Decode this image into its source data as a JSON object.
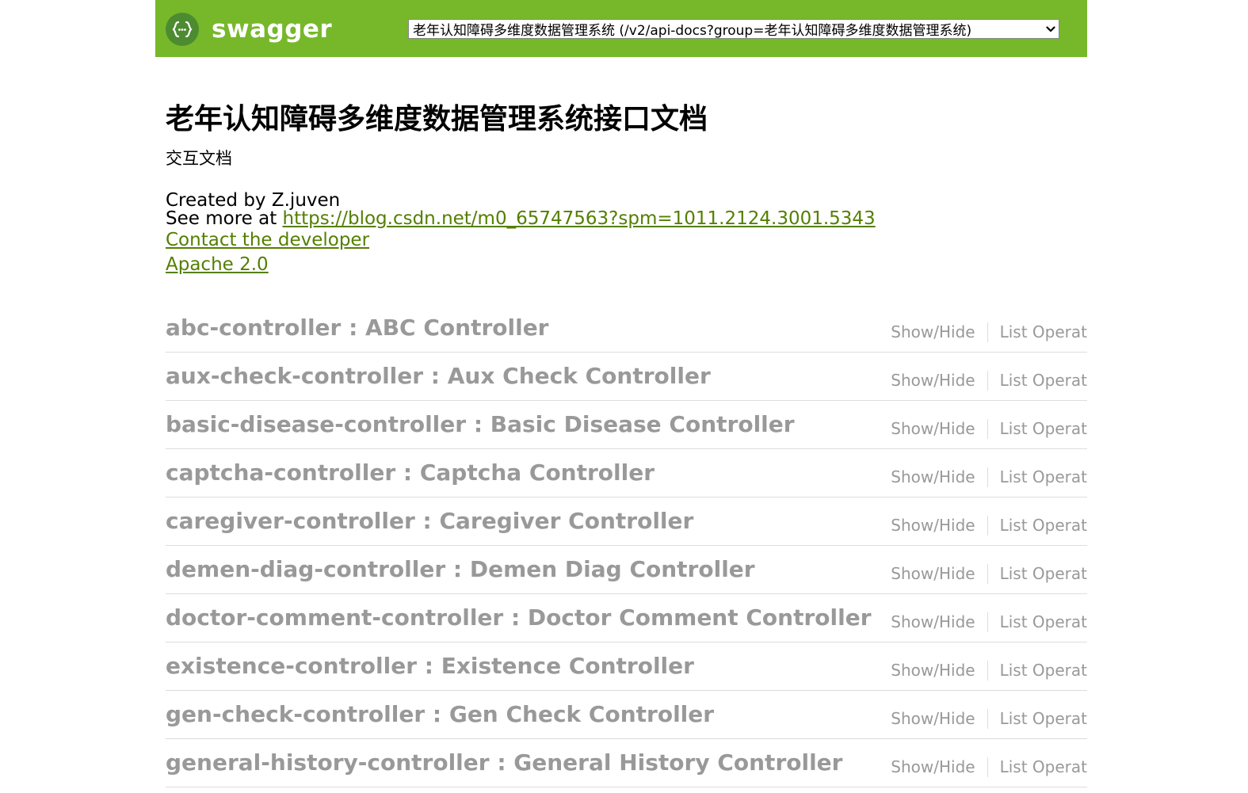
{
  "header": {
    "brand": "swagger",
    "logo_icon": "swagger-braces-icon",
    "colors": {
      "header_bg": "#76b82a",
      "logo_bg": "#4d8b31",
      "link": "#547f00",
      "resource_text": "#999999"
    },
    "api_select": {
      "selected": "老年认知障碍多维度数据管理系统 (/v2/api-docs?group=老年认知障碍多维度数据管理系统)",
      "caret_icon": "chevron-down-icon"
    }
  },
  "info": {
    "title": "老年认知障碍多维度数据管理系统接口文档",
    "description": "交互文档",
    "created_by": "Created by Z.juven",
    "see_more_prefix": "See more at ",
    "see_more_url": "https://blog.csdn.net/m0_65747563?spm=1011.2124.3001.5343",
    "contact_link": "Contact the developer",
    "license_link": "Apache 2.0"
  },
  "resources": {
    "show_hide_label": "Show/Hide",
    "list_operations_label": "List Operat",
    "items": [
      {
        "label": "abc-controller : ABC Controller"
      },
      {
        "label": "aux-check-controller : Aux Check Controller"
      },
      {
        "label": "basic-disease-controller : Basic Disease Controller"
      },
      {
        "label": "captcha-controller : Captcha Controller"
      },
      {
        "label": "caregiver-controller : Caregiver Controller"
      },
      {
        "label": "demen-diag-controller : Demen Diag Controller"
      },
      {
        "label": "doctor-comment-controller : Doctor Comment Controller"
      },
      {
        "label": "existence-controller : Existence Controller"
      },
      {
        "label": "gen-check-controller : Gen Check Controller"
      },
      {
        "label": "general-history-controller : General History Controller"
      }
    ]
  }
}
